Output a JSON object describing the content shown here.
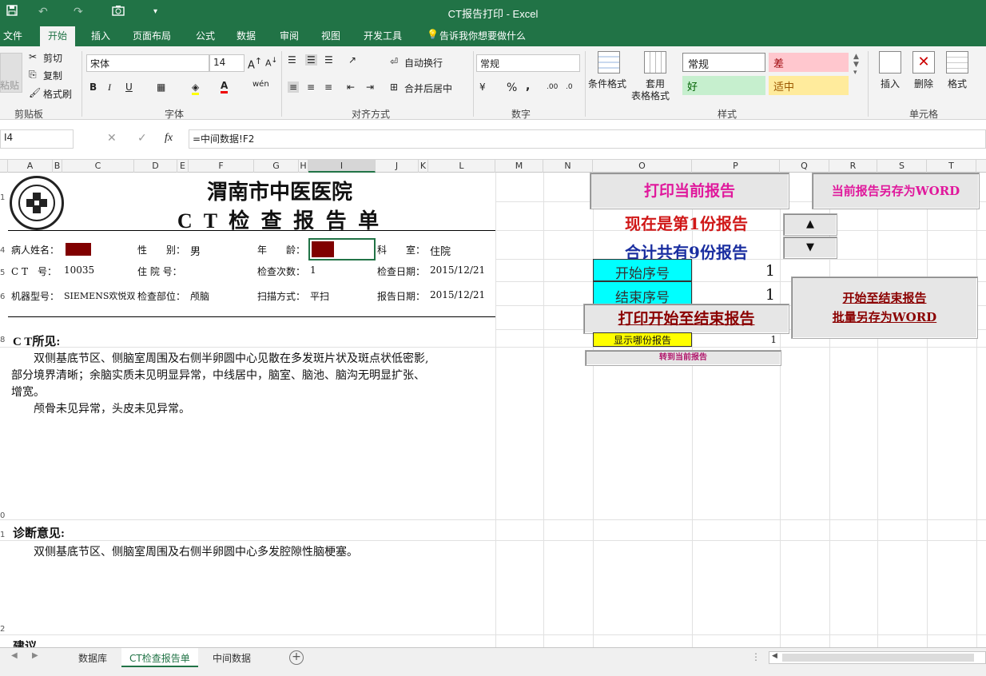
{
  "window": {
    "title": "CT报告打印 - Excel"
  },
  "menu": {
    "file": "文件",
    "home": "开始",
    "insert": "插入",
    "layout": "页面布局",
    "formula": "公式",
    "data": "数据",
    "review": "审阅",
    "view": "视图",
    "dev": "开发工具",
    "tell": "告诉我你想要做什么"
  },
  "ribbon": {
    "clipboard": {
      "group": "剪贴板",
      "paste": "粘贴",
      "cut": "剪切",
      "copy": "复制",
      "format_painter": "格式刷"
    },
    "font": {
      "group": "字体",
      "name": "宋体",
      "size": "14",
      "bold": "B",
      "italic": "I",
      "underline": "U",
      "wen": "wén"
    },
    "align": {
      "group": "对齐方式",
      "wrap": "自动换行",
      "merge": "合并后居中"
    },
    "number": {
      "group": "数字",
      "format": "常规",
      "percent": "%",
      "comma": ","
    },
    "styles": {
      "group": "样式",
      "cond": "条件格式",
      "table1": "套用",
      "table2": "表格格式",
      "normal": "常规",
      "bad": "差",
      "good": "好",
      "neutral": "适中"
    },
    "cells": {
      "group": "单元格",
      "insert": "插入",
      "delete": "删除",
      "format": "格式"
    }
  },
  "formula_bar": {
    "namebox": "I4",
    "fx": "fx",
    "formula": "=中间数据!F2"
  },
  "columns": [
    "A",
    "B",
    "C",
    "D",
    "E",
    "F",
    "G",
    "H",
    "I",
    "J",
    "K",
    "L",
    "M",
    "N",
    "O",
    "P",
    "Q",
    "R",
    "S",
    "T"
  ],
  "report": {
    "hospital": "渭南市中医医院",
    "title": "C T 检 查 报 告 单",
    "name_label": "病人姓名：",
    "sex_label": "性　　别：",
    "sex": "男",
    "age_label": "年　　龄：",
    "dept_label": "科　　室：",
    "dept": "住院",
    "ct_no_label": "C T　号：",
    "ct_no": "10035",
    "inpatient_label": "住 院 号：",
    "exam_count_label": "检查次数：",
    "exam_count": "1",
    "exam_date_label": "检查日期：",
    "exam_date": "2015/12/21",
    "machine_label": "机器型号：",
    "machine": "SIEMENS欢悦双",
    "part_label": "检查部位：",
    "part": "颅脑",
    "scan_label": "扫描方式：",
    "scan": "平扫",
    "report_date_label": "报告日期：",
    "report_date": "2015/12/21",
    "findings_title": "C T所见:",
    "findings_1": "　　双侧基底节区、侧脑室周围及右侧半卵圆中心见散在多发斑片状及斑点状低密影,",
    "findings_2": "部分境界清晰；余脑实质未见明显异常，中线居中，脑室、脑池、脑沟无明显扩张、",
    "findings_3": "增宽。",
    "findings_4": "　　颅骨未见异常，头皮未见异常。",
    "diagnosis_title": "诊断意见:",
    "diagnosis_1": "　　双侧基底节区、侧脑室周围及右侧半卵圆中心多发腔隙性脑梗塞。",
    "advice_title": "建议"
  },
  "controls": {
    "print_current": "打印当前报告",
    "save_word": "当前报告另存为WORD",
    "current_no": "现在是第1份报告",
    "total": "合计共有9份报告",
    "start_label": "开始序号",
    "start_value": "1",
    "end_label": "结束序号",
    "end_value": "1",
    "print_range": "打印开始至结束报告",
    "batch_save_1": "开始至结束报告",
    "batch_save_2": "批量另存为WORD",
    "show_which": "显示哪份报告",
    "show_value": "1",
    "goto_current": "转到当前报告",
    "up": "▲",
    "down": "▼"
  },
  "tabs": {
    "t1": "数据库",
    "t2": "CT检查报告单",
    "t3": "中间数据",
    "add": "+"
  }
}
